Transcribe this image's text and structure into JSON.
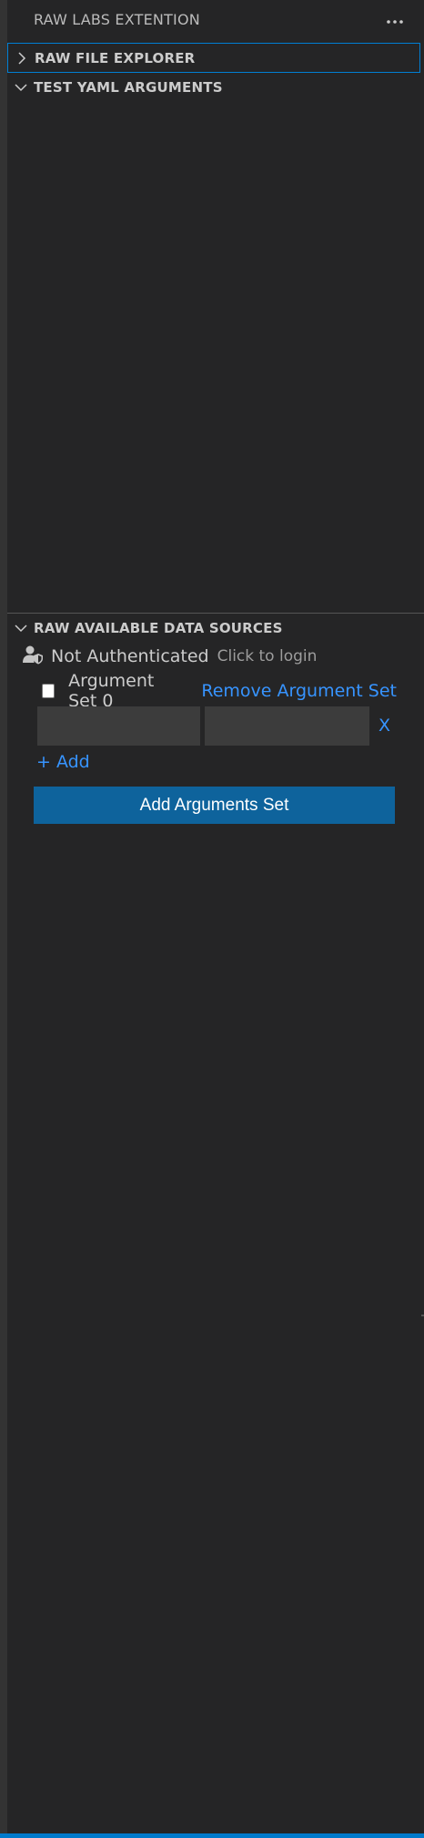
{
  "titlebar": {
    "title": "RAW LABS EXTENTION",
    "more_icon": "ellipsis-icon"
  },
  "sections": {
    "file_explorer": {
      "label": "RAW FILE EXPLORER",
      "expanded": false
    },
    "yaml_arguments": {
      "label": "TEST YAML ARGUMENTS",
      "expanded": true
    },
    "data_sources": {
      "label": "RAW AVAILABLE DATA SOURCES",
      "expanded": true
    }
  },
  "auth": {
    "icon": "user-shield-icon",
    "status": "Not Authenticated",
    "login_label": "Click to login"
  },
  "argument_set": {
    "name": "Argument Set 0",
    "checked": false,
    "remove_label": "Remove Argument Set",
    "key_value": "",
    "value_value": "",
    "remove_pair_label": "X"
  },
  "add_label": "+ Add",
  "add_set_button": "Add Arguments Set",
  "colors": {
    "background": "#252526",
    "accent": "#007acc",
    "link": "#3794ff",
    "button": "#0e639c",
    "input": "#3c3c3c"
  }
}
